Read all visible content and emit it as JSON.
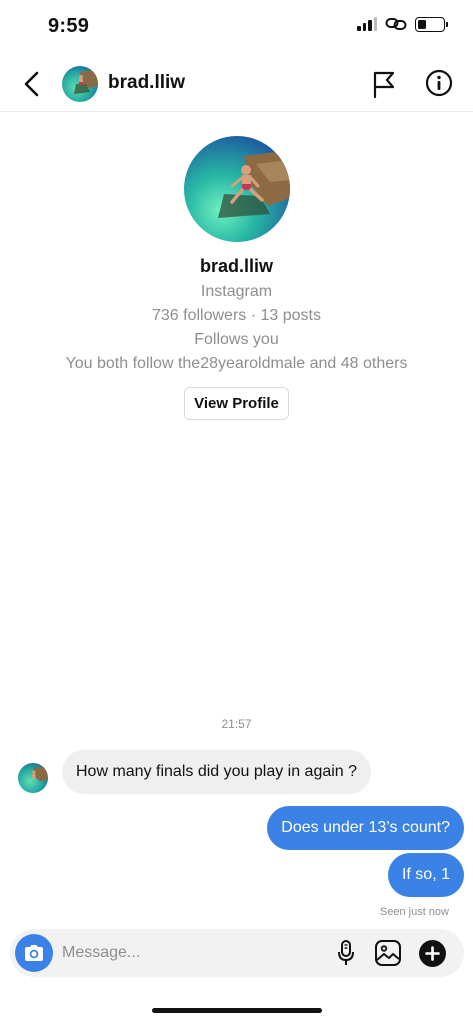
{
  "status_bar": {
    "time": "9:59",
    "battery_level": 0.35,
    "icons": [
      "cellular-signal-icon",
      "link-icon",
      "battery-icon"
    ]
  },
  "header": {
    "username": "brad.lliw",
    "icons": [
      "back-chevron-icon",
      "flag-icon",
      "info-icon"
    ]
  },
  "profile": {
    "username": "brad.lliw",
    "platform": "Instagram",
    "stats": "736 followers · 13 posts",
    "relation": "Follows you",
    "mutual": "You both follow the28yearoldmale and 48 others",
    "button_label": "View Profile"
  },
  "chat": {
    "timestamp": "21:57",
    "messages": [
      {
        "from": "them",
        "text": "How many finals did you play in again ?"
      },
      {
        "from": "me",
        "text": "Does under 13’s count?"
      },
      {
        "from": "me",
        "text": "If so, 1"
      }
    ],
    "seen_status": "Seen just now"
  },
  "composer": {
    "placeholder": "Message...",
    "icons": [
      "camera-icon",
      "microphone-icon",
      "gallery-icon",
      "plus-icon"
    ]
  },
  "colors": {
    "accent": "#3b82e6",
    "incoming_bubble": "#efefef",
    "secondary_text": "#8e8e8e"
  }
}
